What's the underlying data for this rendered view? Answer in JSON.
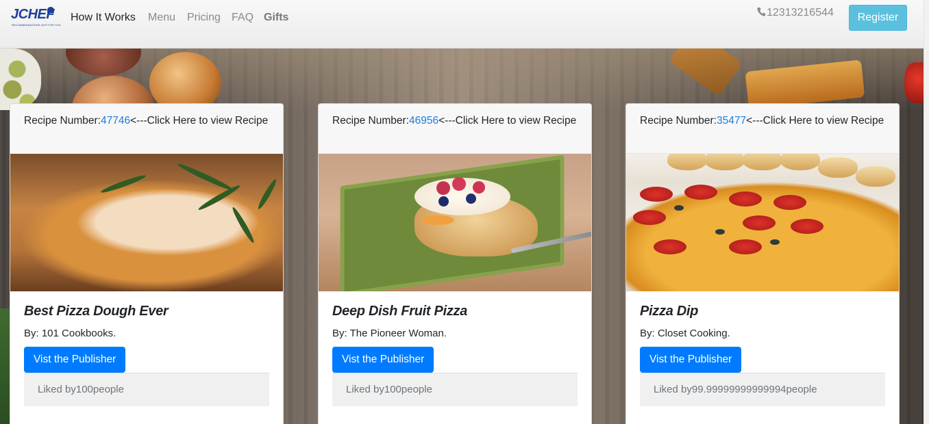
{
  "navbar": {
    "logo_text": "JCHEF",
    "logo_tagline": "RECOMMENDATIONS JUST FOR YOU",
    "links": [
      {
        "label": "How It Works"
      },
      {
        "label": "Menu"
      },
      {
        "label": "Pricing"
      },
      {
        "label": "FAQ"
      },
      {
        "label": "Gifts"
      }
    ],
    "phone": "12313216544",
    "register_label": "Register"
  },
  "cards": [
    {
      "header_prefix": "Recipe Number:",
      "recipe_number": "47746",
      "header_suffix": "<---Click Here to view Recipe",
      "title": "Best Pizza Dough Ever",
      "by": "By: 101 Cookbooks.",
      "button_label": "Vist the Publisher",
      "footer": "Liked by100people"
    },
    {
      "header_prefix": "Recipe Number:",
      "recipe_number": "46956",
      "header_suffix": "<---Click Here to view Recipe",
      "title": "Deep Dish Fruit Pizza",
      "by": "By: The Pioneer Woman.",
      "button_label": "Vist the Publisher",
      "footer": "Liked by100people"
    },
    {
      "header_prefix": "Recipe Number:",
      "recipe_number": "35477",
      "header_suffix": "<---Click Here to view Recipe",
      "title": "Pizza Dip",
      "by": "By: Closet Cooking.",
      "button_label": "Vist the Publisher",
      "footer": "Liked by99.99999999999994people"
    }
  ],
  "colors": {
    "link": "#1a7ee0",
    "primary_button": "#007bff",
    "register_button": "#5bc0de",
    "logo": "#1c3f9a"
  },
  "icons": {
    "phone": "phone-icon"
  }
}
